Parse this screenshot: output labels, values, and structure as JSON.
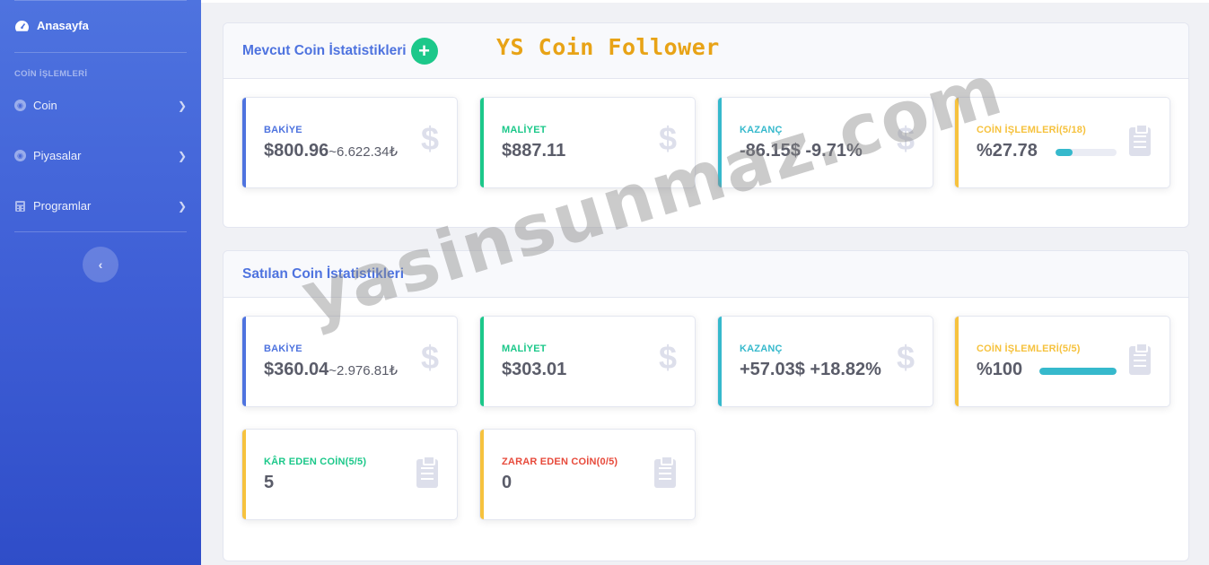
{
  "sidebar": {
    "home": "Anasayfa",
    "heading": "COİN İŞLEMLERİ",
    "items": [
      {
        "label": "Coin"
      },
      {
        "label": "Piyasalar"
      },
      {
        "label": "Programlar"
      }
    ],
    "toggle_glyph": "‹"
  },
  "brand": "YS Coin Follower",
  "watermark": "yasinsunmaz.com",
  "current": {
    "title": "Mevcut Coin İstatistikleri",
    "add_glyph": "+",
    "stats": [
      {
        "label": "BAKİYE",
        "value": "$800.96",
        "sub": "~6.622.34₺",
        "color": "#4e73df"
      },
      {
        "label": "MALİYET",
        "value": "$887.11",
        "color": "#1cc88a"
      },
      {
        "label": "KAZANÇ",
        "value": "-86.15$ -9.71%",
        "color": "#36b9cc"
      },
      {
        "label": "COİN İŞLEMLERİ(5/18)",
        "value": "%27.78",
        "progress": 27.78,
        "color": "#f6c23e"
      }
    ]
  },
  "sold": {
    "title": "Satılan Coin İstatistikleri",
    "stats": [
      {
        "label": "BAKİYE",
        "value": "$360.04",
        "sub": "~2.976.81₺",
        "color": "#4e73df"
      },
      {
        "label": "MALİYET",
        "value": "$303.01",
        "color": "#1cc88a"
      },
      {
        "label": "KAZANÇ",
        "value": "+57.03$ +18.82%",
        "color": "#36b9cc"
      },
      {
        "label": "COİN İŞLEMLERİ(5/5)",
        "value": "%100",
        "progress": 100,
        "color": "#f6c23e"
      },
      {
        "label": "KÂR EDEN COİN(5/5)",
        "value": "5",
        "color": "#f6c23e"
      },
      {
        "label": "ZARAR EDEN COİN(0/5)",
        "value": "0",
        "color": "#f6c23e"
      }
    ]
  },
  "icons": {
    "dollar": "$"
  }
}
